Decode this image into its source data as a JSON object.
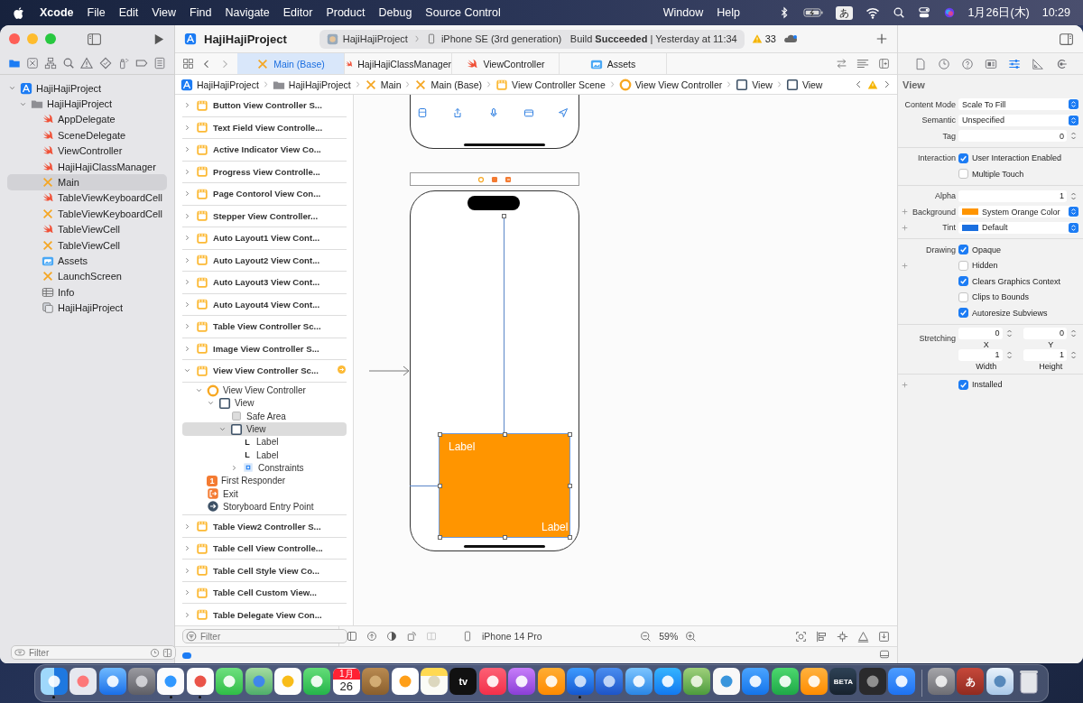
{
  "menu_bar": {
    "app": "Xcode",
    "items": [
      "File",
      "Edit",
      "View",
      "Find",
      "Navigate",
      "Editor",
      "Product",
      "Debug",
      "Source Control"
    ],
    "items_after_notch": [
      "Window",
      "Help"
    ],
    "input_method": "あ",
    "date": "1月26日(木)",
    "time": "10:29"
  },
  "toolbar": {
    "project": "HajiHajiProject",
    "scheme": "HajiHajiProject",
    "device": "iPhone SE (3rd generation)",
    "build_status": "Build **Succeeded** | Yesterday at 11:34",
    "warnings": "33"
  },
  "navigator": {
    "tabs": [
      {
        "kind": "folder",
        "selected": true
      },
      {
        "kind": "x-square",
        "selected": false
      },
      {
        "kind": "hierarchy",
        "selected": false
      },
      {
        "kind": "search",
        "selected": false
      },
      {
        "kind": "warning",
        "selected": false
      },
      {
        "kind": "diamond",
        "selected": false
      },
      {
        "kind": "spray",
        "selected": false
      },
      {
        "kind": "tag",
        "selected": false
      },
      {
        "kind": "list",
        "selected": false
      }
    ],
    "tree": [
      {
        "label": "HajiHajiProject",
        "kind": "project",
        "expanded": true,
        "selected": false,
        "children": [
          {
            "label": "HajiHajiProject",
            "kind": "folder",
            "expanded": true,
            "selected": false,
            "children": [
              {
                "label": "AppDelegate",
                "kind": "swift",
                "selected": false
              },
              {
                "label": "SceneDelegate",
                "kind": "swift",
                "selected": false
              },
              {
                "label": "ViewController",
                "kind": "swift",
                "selected": false
              },
              {
                "label": "HajiHajiClassManager",
                "kind": "swift",
                "selected": false
              },
              {
                "label": "Main",
                "kind": "storyboard",
                "selected": true
              },
              {
                "label": "TableViewKeyboardCell",
                "kind": "swift",
                "selected": false
              },
              {
                "label": "TableViewKeyboardCell",
                "kind": "storyboard",
                "selected": false
              },
              {
                "label": "TableViewCell",
                "kind": "swift",
                "selected": false
              },
              {
                "label": "TableViewCell",
                "kind": "storyboard",
                "selected": false
              },
              {
                "label": "Assets",
                "kind": "assets",
                "selected": false
              },
              {
                "label": "LaunchScreen",
                "kind": "storyboard",
                "selected": false
              },
              {
                "label": "Info",
                "kind": "plist",
                "selected": false
              },
              {
                "label": "HajiHajiProject",
                "kind": "entitlement",
                "selected": false
              }
            ]
          }
        ]
      }
    ],
    "filter": {
      "placeholder": "Filter"
    }
  },
  "editor": {
    "tabs": [
      {
        "label": "Main (Base)",
        "kind": "storyboard",
        "selected": true
      },
      {
        "label": "HajiHajiClassManager",
        "kind": "swift",
        "selected": false
      },
      {
        "label": "ViewController",
        "kind": "swift",
        "selected": false
      },
      {
        "label": "Assets",
        "kind": "assets",
        "selected": false
      }
    ],
    "jump_bar": [
      {
        "label": "HajiHajiProject",
        "kind": "project"
      },
      {
        "label": "HajiHajiProject",
        "kind": "folder"
      },
      {
        "label": "Main",
        "kind": "storyboard"
      },
      {
        "label": "Main (Base)",
        "kind": "storyboard"
      },
      {
        "label": "View Controller Scene",
        "kind": "scene"
      },
      {
        "label": "View View Controller",
        "kind": "vc"
      },
      {
        "label": "View",
        "kind": "view"
      },
      {
        "label": "View",
        "kind": "view"
      }
    ],
    "outline": {
      "scenes": [
        {
          "label": "Button View Controller S...",
          "expanded": false,
          "issue": false
        },
        {
          "label": "Text Field View Controlle...",
          "expanded": false,
          "issue": false
        },
        {
          "label": "Active Indicator View Co...",
          "expanded": false,
          "issue": false
        },
        {
          "label": "Progress View Controlle...",
          "expanded": false,
          "issue": false
        },
        {
          "label": "Page Contorol View Con...",
          "expanded": false,
          "issue": false
        },
        {
          "label": "Stepper View Controller...",
          "expanded": false,
          "issue": false
        },
        {
          "label": "Auto Layout1 View Cont...",
          "expanded": false,
          "issue": false
        },
        {
          "label": "Auto Layout2 View Cont...",
          "expanded": false,
          "issue": false
        },
        {
          "label": "Auto Layout3 View Cont...",
          "expanded": false,
          "issue": false
        },
        {
          "label": "Auto Layout4 View Cont...",
          "expanded": false,
          "issue": false
        },
        {
          "label": "Table View Controller Sc...",
          "expanded": false,
          "issue": false
        },
        {
          "label": "Image View Controller S...",
          "expanded": false,
          "issue": false
        },
        {
          "label": "View View Controller Sc...",
          "expanded": true,
          "issue": true,
          "children": [
            {
              "label": "View View Controller",
              "kind": "vc",
              "expanded": true,
              "selected": false,
              "children": [
                {
                  "label": "View",
                  "kind": "view",
                  "expanded": true,
                  "selected": false,
                  "children": [
                    {
                      "label": "Safe Area",
                      "kind": "safearea",
                      "selected": false
                    },
                    {
                      "label": "View",
                      "kind": "view",
                      "expanded": true,
                      "selected": true,
                      "children": [
                        {
                          "label": "Label",
                          "kind": "label",
                          "icon_text": "L",
                          "selected": false
                        },
                        {
                          "label": "Label",
                          "kind": "label",
                          "icon_text": "L",
                          "selected": false
                        },
                        {
                          "label": "Constraints",
                          "kind": "constraints",
                          "expanded": false,
                          "selected": false
                        }
                      ]
                    }
                  ]
                }
              ]
            },
            {
              "label": "First Responder",
              "kind": "responder",
              "icon_text": "1",
              "selected": false
            },
            {
              "label": "Exit",
              "kind": "exit",
              "selected": false
            },
            {
              "label": "Storyboard Entry Point",
              "kind": "entry",
              "selected": false
            }
          ]
        },
        {
          "label": "Table View2 Controller S...",
          "expanded": false,
          "issue": false
        },
        {
          "label": "Table Cell View Controlle...",
          "expanded": false,
          "issue": false
        },
        {
          "label": "Table Cell Style View Co...",
          "expanded": false,
          "issue": false
        },
        {
          "label": "Table Cell Custom View...",
          "expanded": false,
          "issue": false
        },
        {
          "label": "Table Delegate View Con...",
          "expanded": false,
          "issue": false
        }
      ],
      "filter": {
        "placeholder": "Filter"
      }
    },
    "canvas": {
      "labels": [
        "Label",
        "Label"
      ],
      "device": "iPhone 14 Pro",
      "zoom": "59%"
    }
  },
  "inspector": {
    "tabs": [
      {
        "kind": "file",
        "selected": false
      },
      {
        "kind": "history",
        "selected": false
      },
      {
        "kind": "help",
        "selected": false
      },
      {
        "kind": "identity",
        "selected": false
      },
      {
        "kind": "attributes",
        "selected": true
      },
      {
        "kind": "ruler",
        "selected": false
      },
      {
        "kind": "connections",
        "selected": false
      }
    ],
    "title": "View",
    "sections": [
      [
        {
          "kind": "select",
          "label": "Content Mode",
          "value": "Scale To Fill"
        },
        {
          "kind": "select",
          "label": "Semantic",
          "value": "Unspecified"
        },
        {
          "kind": "number",
          "label": "Tag",
          "value": "0"
        }
      ],
      [
        {
          "kind": "check",
          "label": "Interaction",
          "text": "User Interaction Enabled",
          "checked": true
        },
        {
          "kind": "check",
          "text": "Multiple Touch",
          "checked": false
        }
      ],
      [
        {
          "kind": "number",
          "label": "Alpha",
          "value": "1"
        },
        {
          "kind": "color",
          "label": "Background",
          "value": "System Orange Color",
          "color": "#ff9500",
          "plus": true
        },
        {
          "kind": "color",
          "label": "Tint",
          "value": "Default",
          "color": "#1a6fe0",
          "plus": true
        }
      ],
      [
        {
          "kind": "check",
          "label": "Drawing",
          "text": "Opaque",
          "checked": true
        },
        {
          "kind": "check",
          "text": "Hidden",
          "checked": false,
          "plus": true
        },
        {
          "kind": "check",
          "text": "Clears Graphics Context",
          "checked": true
        },
        {
          "kind": "check",
          "text": "Clips to Bounds",
          "checked": false
        },
        {
          "kind": "check",
          "text": "Autoresize Subviews",
          "checked": true
        }
      ],
      [
        {
          "kind": "pair",
          "label": "Stretching",
          "fields": [
            {
              "value": "0",
              "caption": "X"
            },
            {
              "value": "0",
              "caption": "Y"
            }
          ]
        },
        {
          "kind": "pair",
          "fields": [
            {
              "value": "1",
              "caption": "Width"
            },
            {
              "value": "1",
              "caption": "Height"
            }
          ]
        }
      ],
      [
        {
          "kind": "check",
          "text": "Installed",
          "checked": true,
          "plus": true
        }
      ]
    ]
  },
  "dock": {
    "apps": [
      {
        "kind": "finder",
        "running": true
      },
      {
        "kind": "launchpad",
        "running": false
      },
      {
        "kind": "mail",
        "running": false
      },
      {
        "kind": "settings",
        "running": false
      },
      {
        "kind": "safari",
        "running": true
      },
      {
        "kind": "chrome",
        "running": true
      },
      {
        "kind": "messages",
        "running": false
      },
      {
        "kind": "maps",
        "running": false
      },
      {
        "kind": "photos",
        "running": false
      },
      {
        "kind": "facetime",
        "running": false
      },
      {
        "kind": "calendar",
        "month": "1月",
        "day": "26",
        "running": false
      },
      {
        "kind": "archive",
        "running": false
      },
      {
        "kind": "reminders",
        "running": false
      },
      {
        "kind": "notes",
        "running": false
      },
      {
        "kind": "tv",
        "label": "tv",
        "running": false
      },
      {
        "kind": "music",
        "running": false
      },
      {
        "kind": "podcasts",
        "running": false
      },
      {
        "kind": "books",
        "running": false
      },
      {
        "kind": "xcode",
        "running": true
      },
      {
        "kind": "simulator",
        "running": false
      },
      {
        "kind": "instruments",
        "running": false
      },
      {
        "kind": "appstore",
        "running": false
      },
      {
        "kind": "editor",
        "running": false
      },
      {
        "kind": "vscode",
        "running": false
      },
      {
        "kind": "keynote",
        "running": false
      },
      {
        "kind": "numbers",
        "running": false
      },
      {
        "kind": "pages",
        "running": false
      },
      {
        "kind": "beta",
        "label": "BETA",
        "running": false
      },
      {
        "kind": "terminal",
        "running": false
      },
      {
        "kind": "zoom",
        "running": false
      }
    ],
    "others": [
      {
        "kind": "dictionary",
        "running": false
      },
      {
        "kind": "ime",
        "label": "あ",
        "running": false
      },
      {
        "kind": "preview",
        "running": false
      },
      {
        "kind": "trash",
        "running": false
      }
    ]
  }
}
